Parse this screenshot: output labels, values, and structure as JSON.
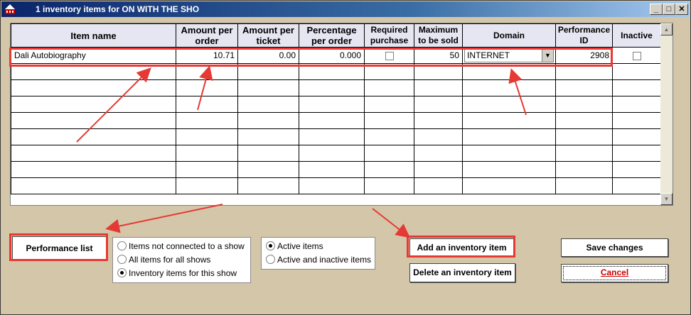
{
  "window": {
    "title": "1 inventory items for ON WITH THE SHO"
  },
  "grid": {
    "headers": [
      "Item name",
      "Amount per order",
      "Amount per ticket",
      "Percentage per order",
      "Required purchase",
      "Maximum to be sold",
      "Domain",
      "Performance ID",
      "Inactive"
    ],
    "rows": [
      {
        "item_name": "Dali Autobiography",
        "amount_per_order": "10.71",
        "amount_per_ticket": "0.00",
        "percentage_per_order": "0.000",
        "required_purchase": false,
        "maximum_to_be_sold": "50",
        "domain": "INTERNET",
        "performance_id": "2908",
        "inactive": false
      }
    ],
    "empty_rows": 8
  },
  "buttons": {
    "performance_list": "Performance list",
    "add_inventory_item": "Add an inventory item",
    "delete_inventory_item": "Delete an inventory item",
    "save_changes": "Save changes",
    "cancel": "Cancel"
  },
  "scope_options": {
    "options": [
      "Items not connected to a show",
      "All items for all shows",
      "Inventory items for this show"
    ],
    "selected": "Inventory items for this show"
  },
  "status_options": {
    "options": [
      "Active items",
      "Active and inactive items"
    ],
    "selected": "Active items"
  },
  "colors": {
    "highlight": "#e53935",
    "header_bg": "#e6e6f2",
    "window_bg": "#d4c6a8",
    "titlebar": "#0a246a"
  }
}
